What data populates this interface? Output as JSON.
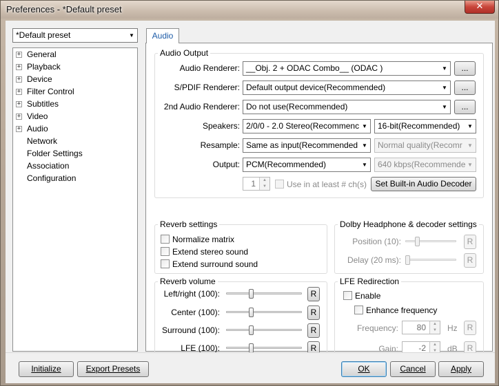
{
  "window": {
    "title": "Preferences - *Default preset",
    "close_glyph": "✕"
  },
  "preset": {
    "selected": "*Default preset"
  },
  "tree": {
    "items": [
      {
        "label": "General",
        "expandable": true
      },
      {
        "label": "Playback",
        "expandable": true
      },
      {
        "label": "Device",
        "expandable": true
      },
      {
        "label": "Filter Control",
        "expandable": true
      },
      {
        "label": "Subtitles",
        "expandable": true
      },
      {
        "label": "Video",
        "expandable": true
      },
      {
        "label": "Audio",
        "expandable": true
      },
      {
        "label": "Network",
        "expandable": false
      },
      {
        "label": "Folder Settings",
        "expandable": false
      },
      {
        "label": "Association",
        "expandable": false
      },
      {
        "label": "Configuration",
        "expandable": false
      }
    ],
    "expand_glyph": "+"
  },
  "tab": {
    "label": "Audio"
  },
  "audio_output": {
    "title": "Audio Output",
    "renderer_label": "Audio Renderer:",
    "renderer_value": "__Obj. 2 + ODAC Combo__ (ODAC )",
    "spdif_label": "S/PDIF Renderer:",
    "spdif_value": "Default output device(Recommended)",
    "second_label": "2nd Audio Renderer:",
    "second_value": "Do not use(Recommended)",
    "browse_label": "...",
    "speakers_label": "Speakers:",
    "speakers_value": "2/0/0 - 2.0 Stereo(Recommenc",
    "bitdepth_value": "16-bit(Recommended)",
    "resample_label": "Resample:",
    "resample_value": "Same as input(Recommended",
    "quality_value": "Normal quality(Recomr",
    "output_label": "Output:",
    "output_value": "PCM(Recommended)",
    "bitrate_value": "640 kbps(Recommende",
    "channels_value": "1",
    "use_in_label": "Use in at least # ch(s)",
    "builtin_button": "Set Built-in Audio Decoder"
  },
  "reverb_settings": {
    "title": "Reverb settings",
    "normalize": "Normalize matrix",
    "extend_stereo": "Extend stereo sound",
    "extend_surround": "Extend surround sound"
  },
  "dolby": {
    "title": "Dolby Headphone & decoder settings",
    "position_label": "Position (10):",
    "delay_label": "Delay (20 ms):",
    "reset_label": "R",
    "position_level": 0.1,
    "delay_level": 0.02
  },
  "reverb_volume": {
    "title": "Reverb volume",
    "leftright_label": "Left/right (100):",
    "center_label": "Center (100):",
    "surround_label": "Surround (100):",
    "lfe_label": "LFE (100):",
    "reset_label": "R",
    "level": 0.33
  },
  "lfe": {
    "title": "LFE Redirection",
    "enable_label": "Enable",
    "enhance_label": "Enhance frequency",
    "frequency_label": "Frequency:",
    "frequency_value": "80",
    "frequency_unit": "Hz",
    "gain_label": "Gain:",
    "gain_value": "-2",
    "gain_unit": "dB",
    "reset_label": "R"
  },
  "buttons": {
    "initialize": "Initialize",
    "export": "Export Presets",
    "ok": "OK",
    "cancel": "Cancel",
    "apply": "Apply"
  },
  "icons": {
    "dropdown": "▼",
    "spin_up": "▲",
    "spin_down": "▼"
  }
}
